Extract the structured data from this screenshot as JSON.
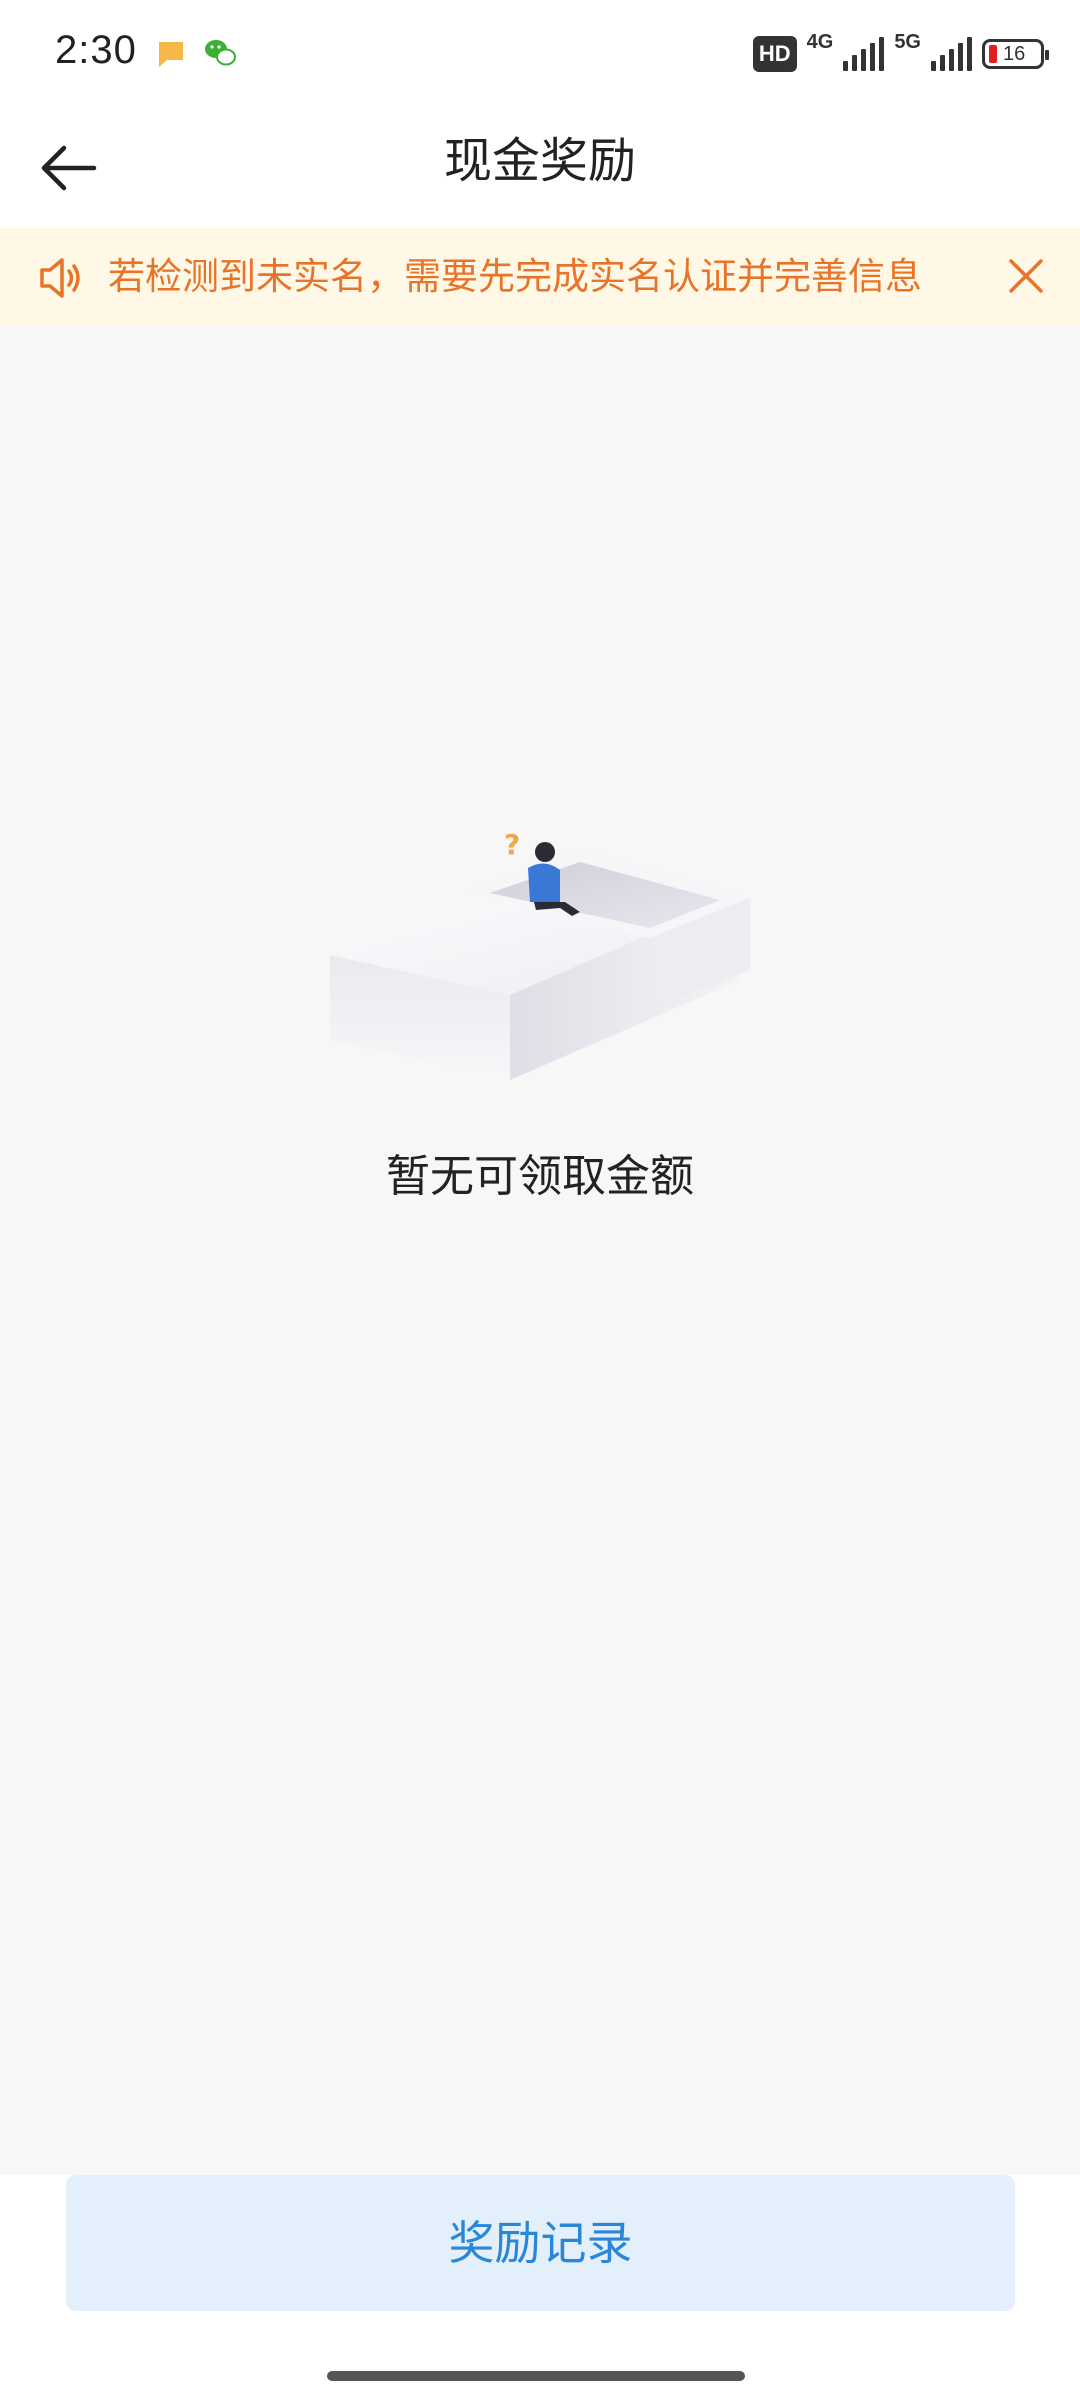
{
  "status_bar": {
    "time": "2:30",
    "network_1": "4G",
    "network_2": "5G",
    "hd_badge": "HD",
    "battery_level": "16",
    "icons": [
      "message-notification-icon",
      "wechat-icon",
      "hd-voice-icon",
      "signal-4g-icon",
      "signal-5g-icon",
      "battery-icon"
    ]
  },
  "nav": {
    "title": "现金奖励",
    "back_icon": "arrow-left-icon"
  },
  "notice": {
    "text": "若检测到未实名，需要先完成实名认证并完善信息",
    "color": "#e8742a",
    "background": "#fff8e6",
    "icon": "speaker-icon",
    "close_icon": "close-icon"
  },
  "empty_state": {
    "message": "暂无可领取金额",
    "illustration": "empty-box-person-illustration"
  },
  "footer": {
    "records_button_label": "奖励记录",
    "accent": "#2a87d8"
  }
}
